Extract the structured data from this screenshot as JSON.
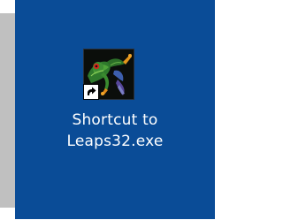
{
  "desktop": {
    "icon": {
      "name": "frog-icon",
      "label_line1": "Shortcut to",
      "label_line2": "Leaps32.exe",
      "shortcut_overlay": "shortcut-arrow-icon"
    }
  },
  "colors": {
    "desktop_background": "#0a4c97",
    "shadow": "#c0c0c0",
    "label_text": "#ffffff"
  }
}
